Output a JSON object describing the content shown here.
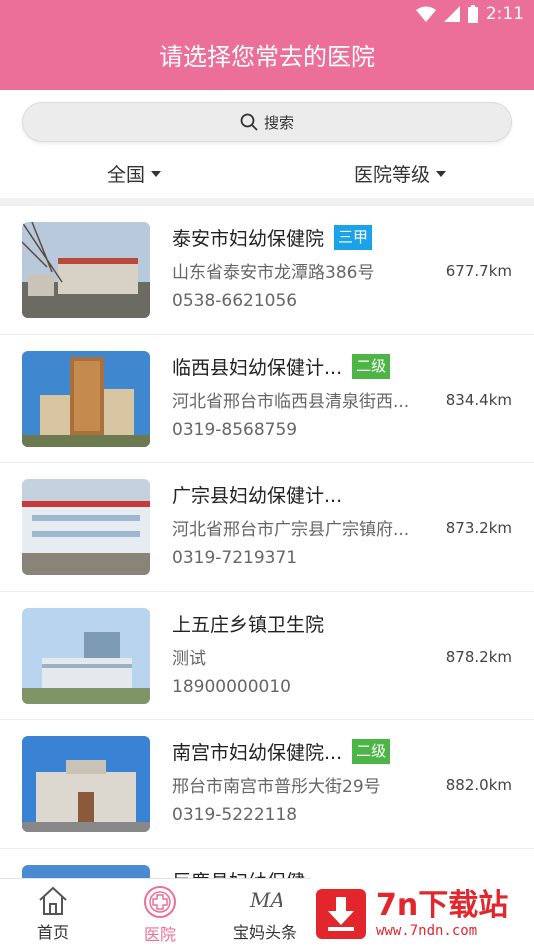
{
  "status": {
    "time": "2:11"
  },
  "header": {
    "title": "请选择您常去的医院"
  },
  "search": {
    "label": "搜索"
  },
  "filters": {
    "region": "全国",
    "level": "医院等级"
  },
  "hospitals": [
    {
      "name": "泰安市妇幼保健院",
      "badge": "三甲",
      "badge_color": "#1aa3e8",
      "address": "山东省泰安市龙潭路386号",
      "phone": "0538-6621056",
      "distance": "677.7km"
    },
    {
      "name": "临西县妇幼保健计...",
      "badge": "二级",
      "badge_color": "#4cb545",
      "address": "河北省邢台市临西县清泉街西...",
      "phone": "0319-8568759",
      "distance": "834.4km"
    },
    {
      "name": "广宗县妇幼保健计...",
      "badge": "",
      "address": "河北省邢台市广宗县广宗镇府...",
      "phone": "0319-7219371",
      "distance": "873.2km"
    },
    {
      "name": "上五庄乡镇卫生院",
      "badge": "",
      "address": "测试",
      "phone": "18900000010",
      "distance": "878.2km"
    },
    {
      "name": "南宫市妇幼保健院...",
      "badge": "二级",
      "badge_color": "#4cb545",
      "address": "邢台市南宫市普彤大街29号",
      "phone": "0319-5222118",
      "distance": "882.0km"
    },
    {
      "name": "巨鹿县妇幼保健",
      "badge": "",
      "address": "",
      "phone": "",
      "distance": ""
    }
  ],
  "tabs": {
    "home": "首页",
    "hospital": "医院",
    "news": "宝妈头条"
  },
  "watermark": {
    "brand": "7n下载站",
    "url": "www.7ndn.com"
  },
  "colors": {
    "accent": "#ec6f9a"
  }
}
